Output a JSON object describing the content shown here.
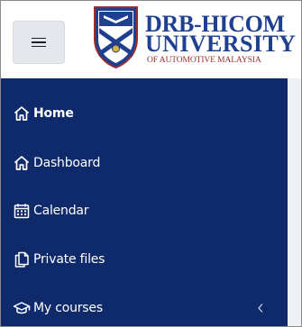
{
  "header": {
    "menu_toggle": {
      "icon": "hamburger-icon"
    },
    "logo": {
      "line1": "DRB-HICOM",
      "line2": "UNIVERSITY",
      "line3": "OF AUTOMOTIVE MALAYSIA",
      "primary_color": "#1f3f91",
      "secondary_color": "#9a2e2e"
    }
  },
  "sidebar": {
    "background": "#0f2a6b",
    "text_color": "#ffffff",
    "items": [
      {
        "label": "Home",
        "icon": "home-icon",
        "active": true
      },
      {
        "label": "Dashboard",
        "icon": "home-icon",
        "active": false
      },
      {
        "label": "Calendar",
        "icon": "calendar-icon",
        "active": false
      },
      {
        "label": "Private files",
        "icon": "files-icon",
        "active": false
      },
      {
        "label": "My courses",
        "icon": "graduation-cap-icon",
        "active": false,
        "expandable": true,
        "expand_icon": "chevron-left-icon"
      }
    ]
  }
}
